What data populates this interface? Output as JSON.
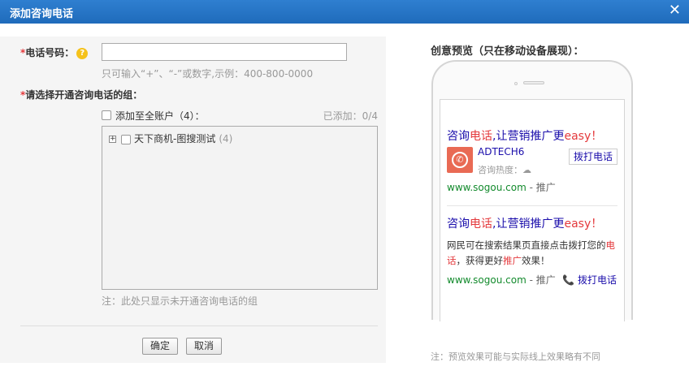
{
  "dialog": {
    "title": "添加咨询电话",
    "close_glyph": "✕"
  },
  "form": {
    "phone_label_required": "*",
    "phone_label": "电话号码：",
    "help_glyph": "?",
    "phone_value": "",
    "phone_hint": "只可输入“+”、“-”或数字,示例：400-800-0000",
    "group_label_required": "*",
    "group_label": "请选择开通咨询电话的组：",
    "all_accounts_label": "添加至全账户（4）：",
    "added_count": "已添加：0/4",
    "tree_items": [
      {
        "expander": "+",
        "name": "天下商机-图搜测试",
        "count": "(4)"
      }
    ],
    "tree_note": "注：此处只显示未开通咨询电话的组",
    "confirm_label": "确定",
    "cancel_label": "取消"
  },
  "preview": {
    "title": "创意预览（只在移动设备展现）：",
    "ad1": {
      "title_a": "咨询",
      "title_red": "电话",
      "title_b": ",让营销推广更",
      "title_red2": "easy！",
      "brand": "ADTECH6",
      "heat_label": "咨询热度：",
      "heat_icon": "☁",
      "call_button": "拨打电话",
      "url": "www.sogou.com",
      "url_suffix": " - 推广"
    },
    "ad2": {
      "title_a": "咨询",
      "title_red": "电话",
      "title_b": ",让营销推广更",
      "title_red2": "easy！",
      "desc_a": "网民可在搜索结果页直接点击拨打您的",
      "desc_red1": "电话",
      "desc_b": "，获得更好",
      "desc_red2": "推广",
      "desc_c": "效果！",
      "url": "www.sogou.com",
      "url_suffix": " - 推广",
      "call_icon": "📞",
      "call_link": "拨打电话"
    },
    "footnote": "注：预览效果可能与实际线上效果略有不同"
  },
  "colors": {
    "titlebar": "#2273c4",
    "link_blue": "#1a0dab",
    "accent_red": "#e4393c",
    "url_green": "#128a2c",
    "icon_bg": "#e96a54"
  }
}
